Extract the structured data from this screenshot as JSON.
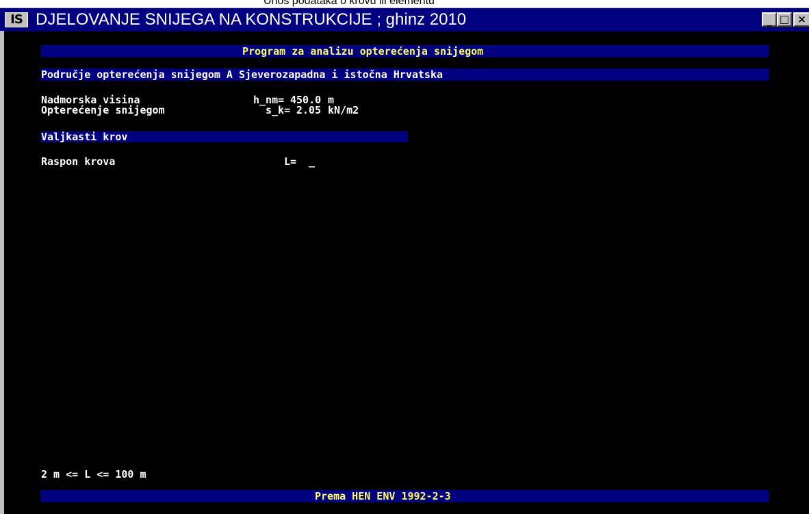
{
  "caption": "Unos podataka o krovu ili elementu",
  "window": {
    "icon_text": "IS",
    "title": "DJELOVANJE SNIJEGA NA KONSTRUKCIJE ; ghinz 2010",
    "min_symbol": "_",
    "max_symbol": "□",
    "close_symbol": "×"
  },
  "header": {
    "program_title": "Program za analizu opterećenja snijegom"
  },
  "region": {
    "label": "Područje opterećenja snijegom A Sjeverozapadna i istočna Hrvatska"
  },
  "parameters": [
    {
      "label": "Nadmorska visina",
      "symbol": "h_nm=",
      "value": "450.0",
      "unit": "m"
    },
    {
      "label": "Opterećenje snijegom",
      "symbol": "s_k=",
      "value": "2.05",
      "unit": "kN/m2"
    }
  ],
  "section": {
    "title": "Valjkasti krov"
  },
  "input": {
    "label": "Raspon krova",
    "symbol": "L=",
    "cursor": "_"
  },
  "hint": {
    "text": "2 m <= L <= 100 m"
  },
  "footer": {
    "text": "Prema HEN ENV 1992-2-3"
  }
}
